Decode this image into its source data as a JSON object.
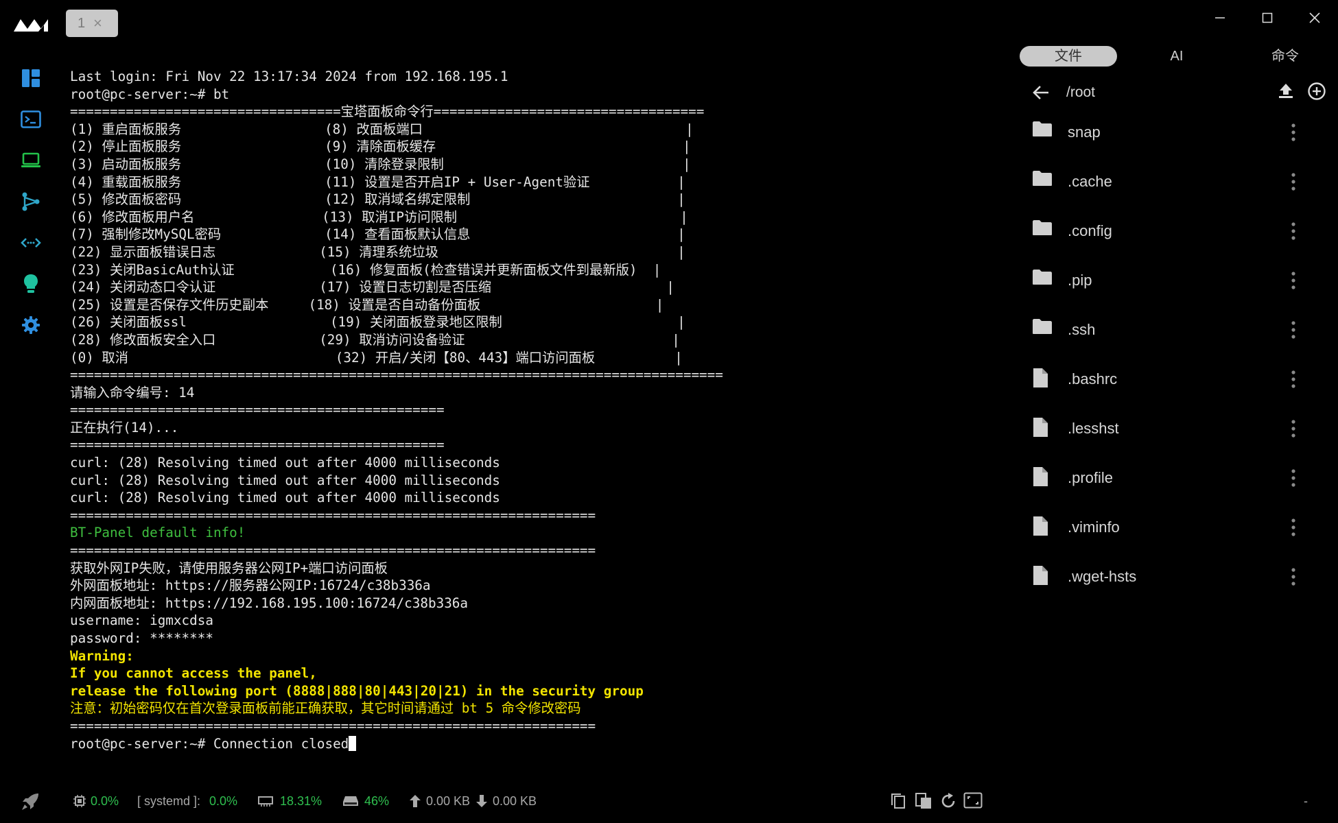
{
  "titlebar": {
    "tab_label": "1",
    "tab_close": "×"
  },
  "sidebar": {
    "items": [
      "dashboard-icon",
      "terminal-icon",
      "host-icon",
      "network-icon",
      "code-icon",
      "bulb-icon",
      "settings-icon"
    ]
  },
  "terminal": {
    "lines": [
      {
        "text": "Last login: Fri Nov 22 13:17:34 2024 from 192.168.195.1",
        "color": "normal"
      },
      {
        "text": "root@pc-server:~# bt",
        "color": "normal"
      },
      {
        "text": "==================================宝塔面板命令行==================================",
        "color": "normal"
      },
      {
        "text": "(1) 重启面板服务                  (8) 改面板端口                                 |",
        "color": "normal"
      },
      {
        "text": "(2) 停止面板服务                  (9) 清除面板缓存                               |",
        "color": "normal"
      },
      {
        "text": "(3) 启动面板服务                  (10) 清除登录限制                              |",
        "color": "normal"
      },
      {
        "text": "(4) 重载面板服务                  (11) 设置是否开启IP + User-Agent验证           |",
        "color": "normal"
      },
      {
        "text": "(5) 修改面板密码                  (12) 取消域名绑定限制                          |",
        "color": "normal"
      },
      {
        "text": "(6) 修改面板用户名                (13) 取消IP访问限制                            |",
        "color": "normal"
      },
      {
        "text": "(7) 强制修改MySQL密码             (14) 查看面板默认信息                          |",
        "color": "normal"
      },
      {
        "text": "(22) 显示面板错误日志             (15) 清理系统垃圾                              |",
        "color": "normal"
      },
      {
        "text": "(23) 关闭BasicAuth认证            (16) 修复面板(检查错误并更新面板文件到最新版)  |",
        "color": "normal"
      },
      {
        "text": "(24) 关闭动态口令认证             (17) 设置日志切割是否压缩                      |",
        "color": "normal"
      },
      {
        "text": "(25) 设置是否保存文件历史副本     (18) 设置是否自动备份面板                      |",
        "color": "normal"
      },
      {
        "text": "(26) 关闭面板ssl                  (19) 关闭面板登录地区限制                      |",
        "color": "normal"
      },
      {
        "text": "(28) 修改面板安全入口             (29) 取消访问设备验证                          |",
        "color": "normal"
      },
      {
        "text": "(0) 取消                          (32) 开启/关闭【80、443】端口访问面板          |",
        "color": "normal"
      },
      {
        "text": "==================================================================================",
        "color": "normal"
      },
      {
        "text": "请输入命令编号: 14",
        "color": "normal"
      },
      {
        "text": "===============================================",
        "color": "normal"
      },
      {
        "text": "正在执行(14)...",
        "color": "normal"
      },
      {
        "text": "===============================================",
        "color": "normal"
      },
      {
        "text": "curl: (28) Resolving timed out after 4000 milliseconds",
        "color": "normal"
      },
      {
        "text": "curl: (28) Resolving timed out after 4000 milliseconds",
        "color": "normal"
      },
      {
        "text": "curl: (28) Resolving timed out after 4000 milliseconds",
        "color": "normal"
      },
      {
        "text": "==================================================================",
        "color": "normal"
      },
      {
        "text": "BT-Panel default info!",
        "color": "green"
      },
      {
        "text": "==================================================================",
        "color": "normal"
      },
      {
        "text": "获取外网IP失败，请使用服务器公网IP+端口访问面板",
        "color": "normal"
      },
      {
        "text": "外网面板地址: https://服务器公网IP:16724/c38b336a",
        "color": "normal"
      },
      {
        "text": "内网面板地址: https://192.168.195.100:16724/c38b336a",
        "color": "normal"
      },
      {
        "text": "username: igmxcdsa",
        "color": "normal"
      },
      {
        "text": "password: ********",
        "color": "normal"
      },
      {
        "text": "Warning:",
        "color": "yellow"
      },
      {
        "text": "If you cannot access the panel,",
        "color": "yellow"
      },
      {
        "text": "release the following port (8888|888|80|443|20|21) in the security group",
        "color": "yellow"
      },
      {
        "text": "注意：初始密码仅在首次登录面板前能正确获取，其它时间请通过 bt 5 命令修改密码",
        "color": "yellow-normal"
      },
      {
        "text": "==================================================================",
        "color": "normal"
      }
    ],
    "prompt_line": "root@pc-server:~# Connection closed"
  },
  "panel": {
    "tabs": [
      "文件",
      "AI",
      "命令"
    ],
    "active_tab": 0,
    "path": "/root",
    "files": [
      {
        "name": "snap",
        "type": "folder"
      },
      {
        "name": ".cache",
        "type": "folder"
      },
      {
        "name": ".config",
        "type": "folder"
      },
      {
        "name": ".pip",
        "type": "folder"
      },
      {
        "name": ".ssh",
        "type": "folder"
      },
      {
        "name": ".bashrc",
        "type": "file"
      },
      {
        "name": ".lesshst",
        "type": "file"
      },
      {
        "name": ".profile",
        "type": "file"
      },
      {
        "name": ".viminfo",
        "type": "file"
      },
      {
        "name": ".wget-hsts",
        "type": "file"
      }
    ]
  },
  "status": {
    "cpu": "0.0%",
    "process_label": "[ systemd ]:",
    "process_value": "0.0%",
    "memory": "18.31%",
    "disk": "46%",
    "upload": "0.00 KB",
    "download": "0.00 KB",
    "trailing": "-"
  },
  "colors": {
    "accent": "#2f8fe0",
    "status_green": "#2fbf4f",
    "warning_yellow": "#f2e400",
    "info_green": "#3fbf3f"
  }
}
